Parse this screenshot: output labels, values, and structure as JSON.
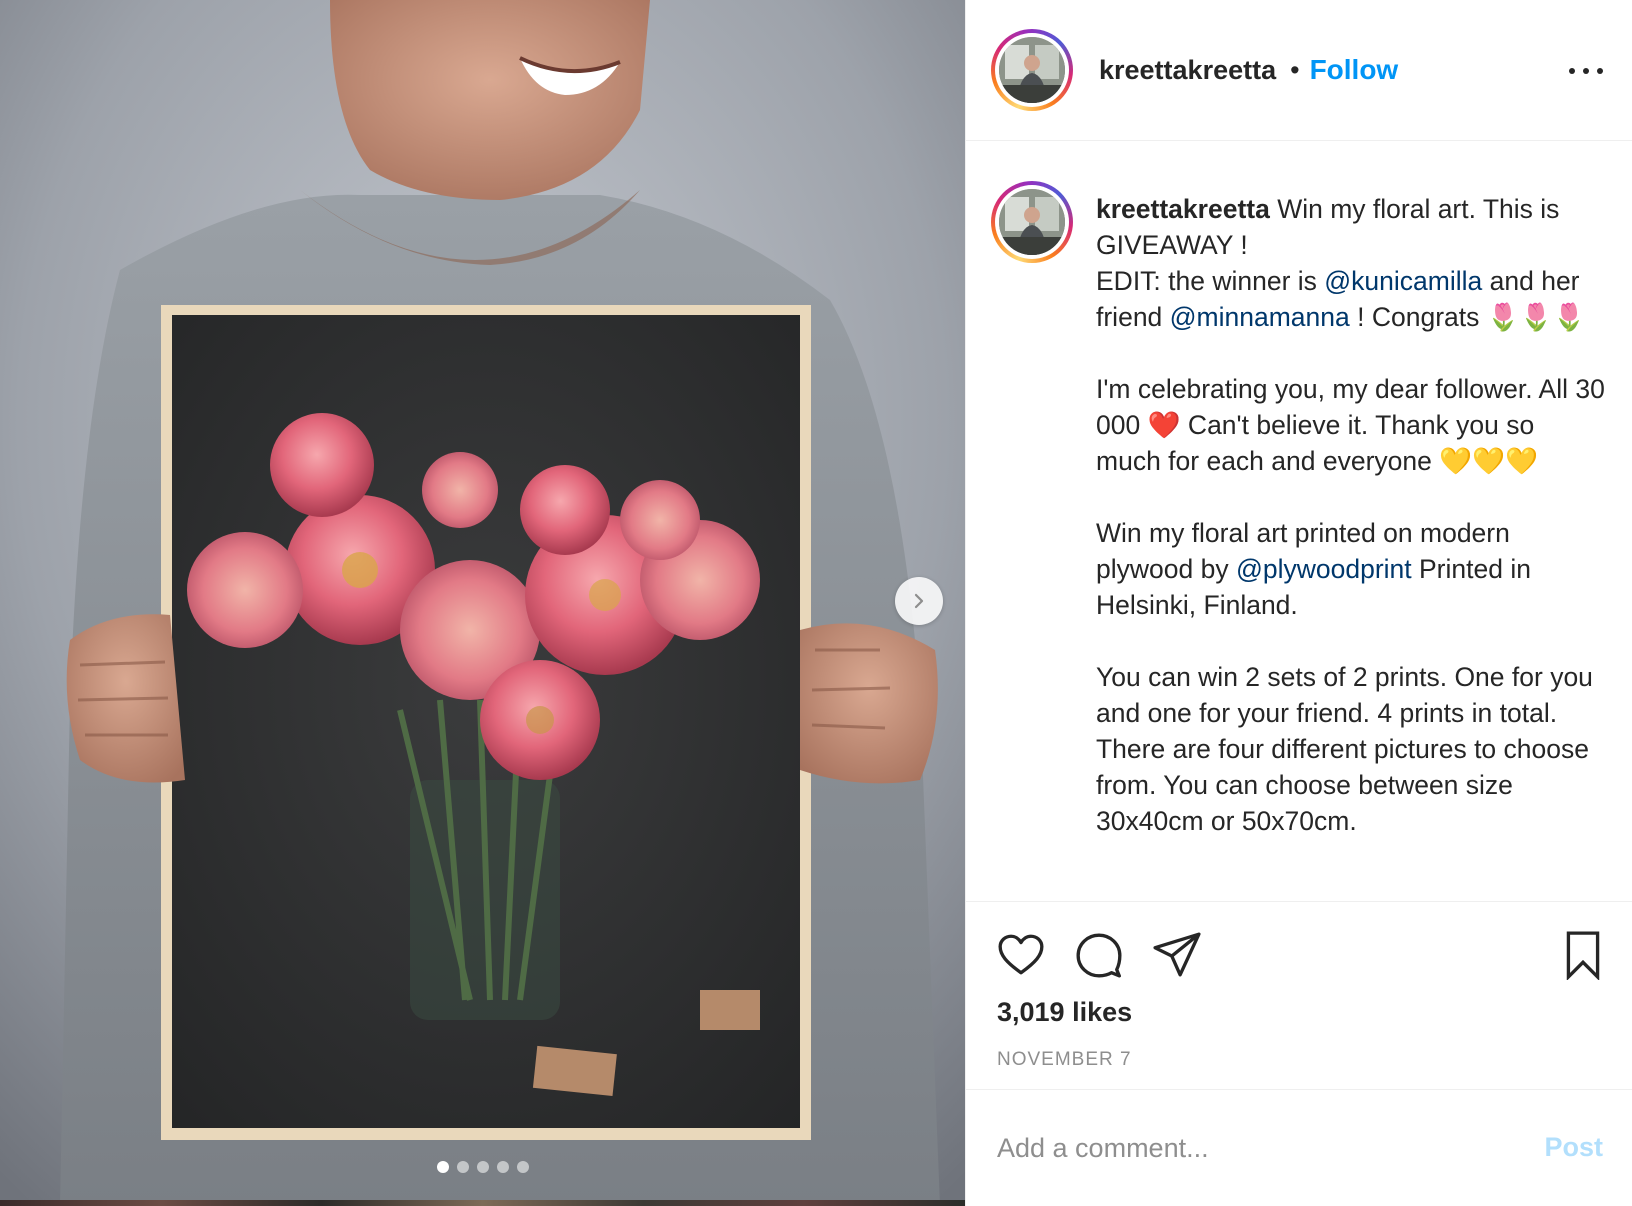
{
  "post": {
    "username": "kreettakreetta",
    "bullet": "•",
    "follow_label": "Follow",
    "more_icon": "more-horizontal-icon"
  },
  "caption": {
    "username": "kreettakreetta",
    "line1": " Win my floral art. This is GIVEAWAY !",
    "edit_prefix": "EDIT: the winner is ",
    "mention1": "@kunicamilla",
    "edit_mid": " and her friend ",
    "mention2": "@minnamanna",
    "edit_suffix": " ! Congrats 🌷🌷🌷",
    "para2": "I'm celebrating you, my dear follower. All 30 000 ❤️ Can't believe it. Thank you so much for each and everyone 💛💛💛",
    "para3_prefix": "Win my floral art printed on modern plywood by ",
    "mention3": "@plywoodprint",
    "para3_suffix": " Printed in Helsinki, Finland.",
    "para4": "You can win 2 sets of 2 prints. One for you and one for your friend. 4 prints in total. There are four different pictures to choose from. You can choose between size 30x40cm or 50x70cm."
  },
  "actions": {
    "like_icon": "heart-icon",
    "comment_icon": "comment-icon",
    "share_icon": "send-icon",
    "save_icon": "bookmark-icon",
    "likes": "3,019 likes",
    "date": "NOVEMBER 7"
  },
  "comment": {
    "placeholder": "Add a comment...",
    "post_label": "Post"
  },
  "carousel": {
    "total_slides": 5,
    "active_slide": 1,
    "next_icon": "chevron-right-icon"
  },
  "colors": {
    "follow": "#0095f6",
    "mention": "#00376b",
    "post_disabled": "#b2dffc",
    "muted": "#8e8e8e"
  }
}
